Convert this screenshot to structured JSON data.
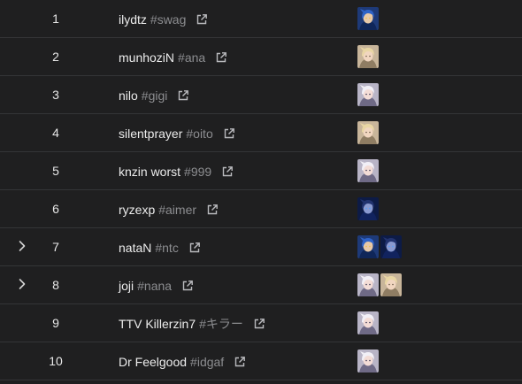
{
  "colors": {
    "background": "#1f1f20",
    "divider": "#343537",
    "name_text": "#ececec",
    "tag_text": "#8c8d90"
  },
  "leaderboard": {
    "rows": [
      {
        "rank": "1",
        "name": "ilydtz",
        "tag": "#swag",
        "expandable": false,
        "agents": [
          "blue-hooded-agent-portrait"
        ]
      },
      {
        "rank": "2",
        "name": "munhoziN",
        "tag": "#ana",
        "expandable": false,
        "agents": [
          "blonde-agent-portrait"
        ]
      },
      {
        "rank": "3",
        "name": "nilo",
        "tag": "#gigi",
        "expandable": false,
        "agents": [
          "white-haired-agent-portrait"
        ]
      },
      {
        "rank": "4",
        "name": "silentprayer",
        "tag": "#oito",
        "expandable": false,
        "agents": [
          "blonde-agent-portrait"
        ]
      },
      {
        "rank": "5",
        "name": "knzin worst",
        "tag": "#999",
        "expandable": false,
        "agents": [
          "white-haired-agent-portrait"
        ]
      },
      {
        "rank": "6",
        "name": "ryzexp",
        "tag": "#aimer",
        "expandable": false,
        "agents": [
          "dark-blue-agent-portrait"
        ]
      },
      {
        "rank": "7",
        "name": "nataN",
        "tag": "#ntc",
        "expandable": true,
        "agents": [
          "blue-hooded-agent-portrait",
          "dark-blue-agent-portrait"
        ]
      },
      {
        "rank": "8",
        "name": "joji",
        "tag": "#nana",
        "expandable": true,
        "agents": [
          "white-haired-agent-portrait",
          "blonde-agent-portrait"
        ]
      },
      {
        "rank": "9",
        "name": "TTV Killerzin7",
        "tag": "#キラー",
        "expandable": false,
        "agents": [
          "white-haired-agent-portrait"
        ]
      },
      {
        "rank": "10",
        "name": "Dr Feelgood",
        "tag": "#idgaf",
        "expandable": false,
        "agents": [
          "white-haired-agent-portrait"
        ]
      }
    ]
  }
}
